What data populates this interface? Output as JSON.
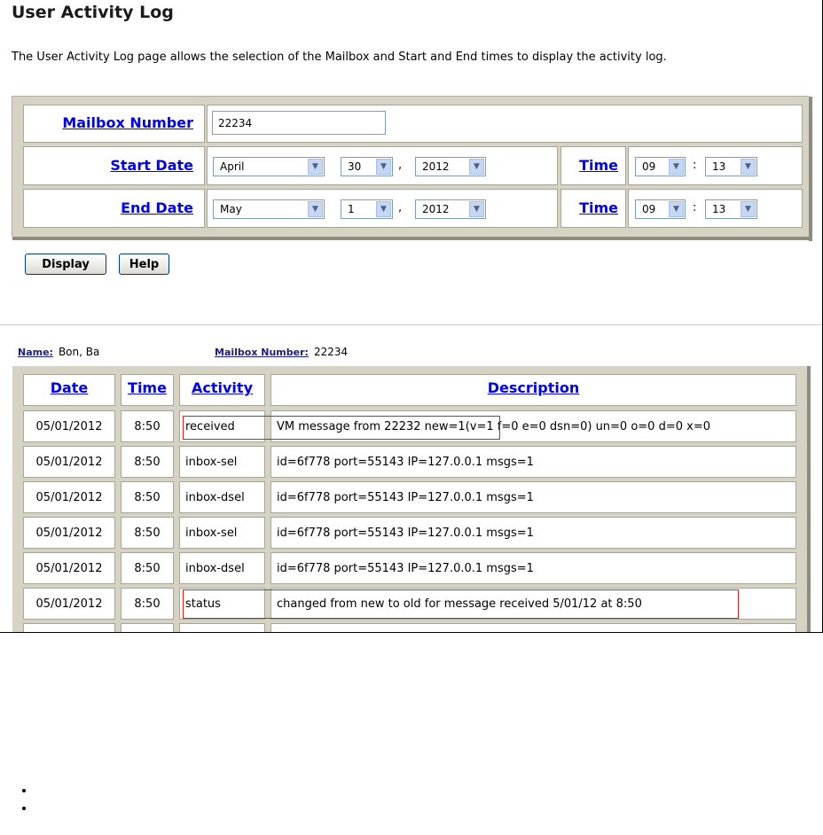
{
  "page": {
    "title": "User Activity Log",
    "intro": "The User Activity Log page allows the selection of the Mailbox and Start and End times to display the activity log."
  },
  "form": {
    "mailbox_label": "Mailbox Number",
    "mailbox_value": "22234",
    "start_label": "Start Date",
    "end_label": "End Date",
    "time_label": "Time",
    "comma": ",",
    "colon": ":",
    "start": {
      "month": "April",
      "day": "30",
      "year": "2012",
      "hour": "09",
      "minute": "13"
    },
    "end": {
      "month": "May",
      "day": "1",
      "year": "2012",
      "hour": "09",
      "minute": "13"
    }
  },
  "buttons": {
    "display": "Display",
    "help": "Help"
  },
  "result_meta": {
    "name_label": "Name:",
    "name_value": "Bon, Ba",
    "mailbox_label": "Mailbox Number:",
    "mailbox_value": "22234"
  },
  "table": {
    "headers": [
      "Date",
      "Time",
      "Activity",
      "Description"
    ],
    "rows": [
      [
        "05/01/2012",
        "8:50",
        "received",
        "VM message from 22232 new=1(v=1 f=0 e=0 dsn=0) un=0 o=0 d=0 x=0"
      ],
      [
        "05/01/2012",
        "8:50",
        "inbox-sel",
        "id=6f778 port=55143 IP=127.0.0.1 msgs=1"
      ],
      [
        "05/01/2012",
        "8:50",
        "inbox-dsel",
        "id=6f778 port=55143 IP=127.0.0.1 msgs=1"
      ],
      [
        "05/01/2012",
        "8:50",
        "inbox-sel",
        "id=6f778 port=55143 IP=127.0.0.1 msgs=1"
      ],
      [
        "05/01/2012",
        "8:50",
        "inbox-dsel",
        "id=6f778 port=55143 IP=127.0.0.1 msgs=1"
      ],
      [
        "05/01/2012",
        "8:50",
        "status",
        "changed from new to old for message received 5/01/12 at 8:50"
      ]
    ]
  },
  "colors": {
    "link": "#0000ee",
    "highlight": "#e01b1b",
    "panel": "#d6d3c4"
  },
  "icons": {
    "select_arrow": "chevron-down-icon"
  }
}
